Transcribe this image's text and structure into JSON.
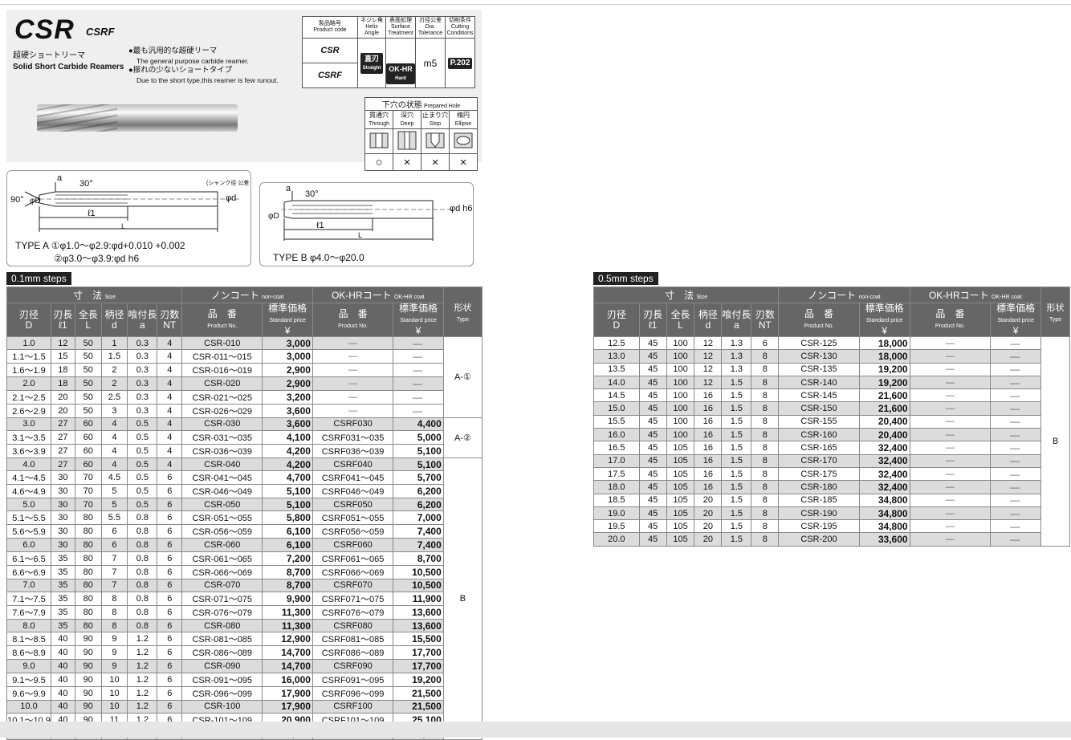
{
  "product": {
    "code": "CSR",
    "variant": "CSRF",
    "name_jp": "超硬ショートリーマ",
    "name_en": "Solid Short Carbide Reamers",
    "bullet1_jp": "●最も汎用的な超硬リーマ",
    "bullet1_en": "The general purpose carbide reamer.",
    "bullet2_jp": "●振れの少ないショートタイプ",
    "bullet2_en": "Due to the short type,this reamer is few runout."
  },
  "spec": {
    "h_code": "製品略号",
    "h_code_en": "Product code",
    "h_helix": "ネジレ角",
    "h_helix_en": "Helix Angle",
    "h_surface": "表面処理",
    "h_surface_en": "Surface Treatment",
    "h_tol": "刃径公差",
    "h_tol_en": "Dia. Tolerance",
    "h_cut": "切削条件",
    "h_cut_en": "Cutting Conditions",
    "row1": "CSR",
    "row2": "CSRF",
    "straight_jp": "直刃",
    "straight_en": "Straight",
    "hard": "OK-HR",
    "hard_en": "Hard",
    "tolerance": "m5",
    "page_ref": "P.202"
  },
  "prepared_hole": {
    "title": "下穴の状態",
    "title_en": "Prepared Hole",
    "cols": [
      {
        "jp": "貫通穴",
        "en": "Through",
        "mark": "○"
      },
      {
        "jp": "深穴",
        "en": "Deep",
        "mark": "×"
      },
      {
        "jp": "止まり穴",
        "en": "Stop",
        "mark": "×"
      },
      {
        "jp": "楕円",
        "en": "Ellipse",
        "mark": "×"
      }
    ]
  },
  "diagram_a": {
    "a": "a",
    "angle": "30°",
    "angle90": "90°",
    "l1": "ℓ1",
    "L": "L",
    "phiD": "φD",
    "phid": "φd",
    "shank_note": "(シャンク径 公差",
    "type_label": "TYPE A ①φ1.0～φ2.9:φd+0.010 +0.002",
    "type_label2": "②φ3.0～φ3.9:φd h6"
  },
  "diagram_b": {
    "a": "a",
    "angle": "30°",
    "l1": "ℓ1",
    "L": "L",
    "phiD": "φD",
    "phid": "φd h6",
    "type_label": "TYPE B φ4.0～φ20.0"
  },
  "table_headers": {
    "size": "寸　法",
    "size_en": "Size",
    "noncoat": "ノンコート",
    "noncoat_en": "non-coat",
    "okhr": "OK-HRコート",
    "okhr_en": "OK-HR coat",
    "shape": "形状",
    "shape_en": "Type",
    "D": "刃径",
    "D_sym": "D",
    "l1": "刃長",
    "l1_sym": "ℓ1",
    "L": "全長",
    "L_sym": "L",
    "d": "柄径",
    "d_sym": "d",
    "a": "喰付長",
    "a_sym": "a",
    "nt": "刃数",
    "nt_sym": "NT",
    "pn": "品　番",
    "pn_en": "Product No.",
    "price": "標準価格",
    "price_en": "Standard price",
    "yen": "¥"
  },
  "left_table": {
    "tag": "0.1mm steps",
    "type_labels": {
      "a1": "A-①",
      "a2": "A-②",
      "b": "B"
    },
    "rows": [
      {
        "D": "1.0",
        "l1": "12",
        "L": "50",
        "d": "1",
        "a": "0.3",
        "nt": "4",
        "pn": "CSR-010",
        "price": "3,000",
        "hr_pn": "—",
        "hr_price": "—",
        "shade": true
      },
      {
        "D": "1.1～1.5",
        "l1": "15",
        "L": "50",
        "d": "1.5",
        "a": "0.3",
        "nt": "4",
        "pn": "CSR-011～015",
        "price": "3,000",
        "hr_pn": "—",
        "hr_price": "—",
        "shade": false
      },
      {
        "D": "1.6～1.9",
        "l1": "18",
        "L": "50",
        "d": "2",
        "a": "0.3",
        "nt": "4",
        "pn": "CSR-016～019",
        "price": "2,900",
        "hr_pn": "—",
        "hr_price": "—",
        "shade": false
      },
      {
        "D": "2.0",
        "l1": "18",
        "L": "50",
        "d": "2",
        "a": "0.3",
        "nt": "4",
        "pn": "CSR-020",
        "price": "2,900",
        "hr_pn": "—",
        "hr_price": "—",
        "shade": true
      },
      {
        "D": "2.1～2.5",
        "l1": "20",
        "L": "50",
        "d": "2.5",
        "a": "0.3",
        "nt": "4",
        "pn": "CSR-021～025",
        "price": "3,200",
        "hr_pn": "—",
        "hr_price": "—",
        "shade": false
      },
      {
        "D": "2.6～2.9",
        "l1": "20",
        "L": "50",
        "d": "3",
        "a": "0.3",
        "nt": "4",
        "pn": "CSR-026～029",
        "price": "3,600",
        "hr_pn": "—",
        "hr_price": "—",
        "shade": false
      },
      {
        "D": "3.0",
        "l1": "27",
        "L": "60",
        "d": "4",
        "a": "0.5",
        "nt": "4",
        "pn": "CSR-030",
        "price": "3,600",
        "hr_pn": "CSRF030",
        "hr_price": "4,400",
        "shade": true
      },
      {
        "D": "3.1～3.5",
        "l1": "27",
        "L": "60",
        "d": "4",
        "a": "0.5",
        "nt": "4",
        "pn": "CSR-031～035",
        "price": "4,100",
        "hr_pn": "CSRF031～035",
        "hr_price": "5,000",
        "shade": false
      },
      {
        "D": "3.6～3.9",
        "l1": "27",
        "L": "60",
        "d": "4",
        "a": "0.5",
        "nt": "4",
        "pn": "CSR-036～039",
        "price": "4,200",
        "hr_pn": "CSRF036～039",
        "hr_price": "5,100",
        "shade": false
      },
      {
        "D": "4.0",
        "l1": "27",
        "L": "60",
        "d": "4",
        "a": "0.5",
        "nt": "4",
        "pn": "CSR-040",
        "price": "4,200",
        "hr_pn": "CSRF040",
        "hr_price": "5,100",
        "shade": true
      },
      {
        "D": "4.1～4.5",
        "l1": "30",
        "L": "70",
        "d": "4.5",
        "a": "0.5",
        "nt": "6",
        "pn": "CSR-041～045",
        "price": "4,700",
        "hr_pn": "CSRF041～045",
        "hr_price": "5,700",
        "shade": false
      },
      {
        "D": "4.6～4.9",
        "l1": "30",
        "L": "70",
        "d": "5",
        "a": "0.5",
        "nt": "6",
        "pn": "CSR-046～049",
        "price": "5,100",
        "hr_pn": "CSRF046～049",
        "hr_price": "6,200",
        "shade": false
      },
      {
        "D": "5.0",
        "l1": "30",
        "L": "70",
        "d": "5",
        "a": "0.5",
        "nt": "6",
        "pn": "CSR-050",
        "price": "5,100",
        "hr_pn": "CSRF050",
        "hr_price": "6,200",
        "shade": true
      },
      {
        "D": "5.1～5.5",
        "l1": "30",
        "L": "80",
        "d": "5.5",
        "a": "0.8",
        "nt": "6",
        "pn": "CSR-051～055",
        "price": "5,800",
        "hr_pn": "CSRF051～055",
        "hr_price": "7,000",
        "shade": false
      },
      {
        "D": "5.6～5.9",
        "l1": "30",
        "L": "80",
        "d": "6",
        "a": "0.8",
        "nt": "6",
        "pn": "CSR-056～059",
        "price": "6,100",
        "hr_pn": "CSRF056～059",
        "hr_price": "7,400",
        "shade": false
      },
      {
        "D": "6.0",
        "l1": "30",
        "L": "80",
        "d": "6",
        "a": "0.8",
        "nt": "6",
        "pn": "CSR-060",
        "price": "6,100",
        "hr_pn": "CSRF060",
        "hr_price": "7,400",
        "shade": true
      },
      {
        "D": "6.1～6.5",
        "l1": "35",
        "L": "80",
        "d": "7",
        "a": "0.8",
        "nt": "6",
        "pn": "CSR-061～065",
        "price": "7,200",
        "hr_pn": "CSRF061～065",
        "hr_price": "8,700",
        "shade": false
      },
      {
        "D": "6.6～6.9",
        "l1": "35",
        "L": "80",
        "d": "7",
        "a": "0.8",
        "nt": "6",
        "pn": "CSR-066～069",
        "price": "8,700",
        "hr_pn": "CSRF066～069",
        "hr_price": "10,500",
        "shade": false
      },
      {
        "D": "7.0",
        "l1": "35",
        "L": "80",
        "d": "7",
        "a": "0.8",
        "nt": "6",
        "pn": "CSR-070",
        "price": "8,700",
        "hr_pn": "CSRF070",
        "hr_price": "10,500",
        "shade": true
      },
      {
        "D": "7.1～7.5",
        "l1": "35",
        "L": "80",
        "d": "8",
        "a": "0.8",
        "nt": "6",
        "pn": "CSR-071～075",
        "price": "9,900",
        "hr_pn": "CSRF071～075",
        "hr_price": "11,900",
        "shade": false
      },
      {
        "D": "7.6～7.9",
        "l1": "35",
        "L": "80",
        "d": "8",
        "a": "0.8",
        "nt": "6",
        "pn": "CSR-076～079",
        "price": "11,300",
        "hr_pn": "CSRF076～079",
        "hr_price": "13,600",
        "shade": false
      },
      {
        "D": "8.0",
        "l1": "35",
        "L": "80",
        "d": "8",
        "a": "0.8",
        "nt": "6",
        "pn": "CSR-080",
        "price": "11,300",
        "hr_pn": "CSRF080",
        "hr_price": "13,600",
        "shade": true
      },
      {
        "D": "8.1～8.5",
        "l1": "40",
        "L": "90",
        "d": "9",
        "a": "1.2",
        "nt": "6",
        "pn": "CSR-081～085",
        "price": "12,900",
        "hr_pn": "CSRF081～085",
        "hr_price": "15,500",
        "shade": false
      },
      {
        "D": "8.6～8.9",
        "l1": "40",
        "L": "90",
        "d": "9",
        "a": "1.2",
        "nt": "6",
        "pn": "CSR-086～089",
        "price": "14,700",
        "hr_pn": "CSRF086～089",
        "hr_price": "17,700",
        "shade": false
      },
      {
        "D": "9.0",
        "l1": "40",
        "L": "90",
        "d": "9",
        "a": "1.2",
        "nt": "6",
        "pn": "CSR-090",
        "price": "14,700",
        "hr_pn": "CSRF090",
        "hr_price": "17,700",
        "shade": true
      },
      {
        "D": "9.1～9.5",
        "l1": "40",
        "L": "90",
        "d": "10",
        "a": "1.2",
        "nt": "6",
        "pn": "CSR-091～095",
        "price": "16,000",
        "hr_pn": "CSRF091～095",
        "hr_price": "19,200",
        "shade": false
      },
      {
        "D": "9.6～9.9",
        "l1": "40",
        "L": "90",
        "d": "10",
        "a": "1.2",
        "nt": "6",
        "pn": "CSR-096～099",
        "price": "17,900",
        "hr_pn": "CSRF096～099",
        "hr_price": "21,500",
        "shade": false
      },
      {
        "D": "10.0",
        "l1": "40",
        "L": "90",
        "d": "10",
        "a": "1.2",
        "nt": "6",
        "pn": "CSR-100",
        "price": "17,900",
        "hr_pn": "CSRF100",
        "hr_price": "21,500",
        "shade": true
      },
      {
        "D": "10.1～10.9",
        "l1": "40",
        "L": "90",
        "d": "11",
        "a": "1.2",
        "nt": "6",
        "pn": "CSR-101～109",
        "price": "20,900",
        "hr_pn": "CSRF101～109",
        "hr_price": "25,100",
        "shade": false
      },
      {
        "D": "11.0",
        "l1": "40",
        "L": "90",
        "d": "11",
        "a": "1.2",
        "nt": "6",
        "pn": "CSR-110",
        "price": "20,900",
        "hr_pn": "CSRF110",
        "hr_price": "25,100",
        "shade": true
      }
    ]
  },
  "right_table": {
    "tag": "0.5mm steps",
    "type_label": "B",
    "rows": [
      {
        "D": "12.5",
        "l1": "45",
        "L": "100",
        "d": "12",
        "a": "1.3",
        "nt": "6",
        "pn": "CSR-125",
        "price": "18,000",
        "hr_pn": "—",
        "hr_price": "—",
        "shade": false
      },
      {
        "D": "13.0",
        "l1": "45",
        "L": "100",
        "d": "12",
        "a": "1.3",
        "nt": "8",
        "pn": "CSR-130",
        "price": "18,000",
        "hr_pn": "—",
        "hr_price": "—",
        "shade": true
      },
      {
        "D": "13.5",
        "l1": "45",
        "L": "100",
        "d": "12",
        "a": "1.3",
        "nt": "8",
        "pn": "CSR-135",
        "price": "19,200",
        "hr_pn": "—",
        "hr_price": "—",
        "shade": false
      },
      {
        "D": "14.0",
        "l1": "45",
        "L": "100",
        "d": "12",
        "a": "1.5",
        "nt": "8",
        "pn": "CSR-140",
        "price": "19,200",
        "hr_pn": "—",
        "hr_price": "—",
        "shade": true
      },
      {
        "D": "14.5",
        "l1": "45",
        "L": "100",
        "d": "16",
        "a": "1.5",
        "nt": "8",
        "pn": "CSR-145",
        "price": "21,600",
        "hr_pn": "—",
        "hr_price": "—",
        "shade": false
      },
      {
        "D": "15.0",
        "l1": "45",
        "L": "100",
        "d": "16",
        "a": "1.5",
        "nt": "8",
        "pn": "CSR-150",
        "price": "21,600",
        "hr_pn": "—",
        "hr_price": "—",
        "shade": true
      },
      {
        "D": "15.5",
        "l1": "45",
        "L": "100",
        "d": "16",
        "a": "1.5",
        "nt": "8",
        "pn": "CSR-155",
        "price": "20,400",
        "hr_pn": "—",
        "hr_price": "—",
        "shade": false
      },
      {
        "D": "16.0",
        "l1": "45",
        "L": "100",
        "d": "16",
        "a": "1.5",
        "nt": "8",
        "pn": "CSR-160",
        "price": "20,400",
        "hr_pn": "—",
        "hr_price": "—",
        "shade": true
      },
      {
        "D": "16.5",
        "l1": "45",
        "L": "105",
        "d": "16",
        "a": "1.5",
        "nt": "8",
        "pn": "CSR-165",
        "price": "32,400",
        "hr_pn": "—",
        "hr_price": "—",
        "shade": false
      },
      {
        "D": "17.0",
        "l1": "45",
        "L": "105",
        "d": "16",
        "a": "1.5",
        "nt": "8",
        "pn": "CSR-170",
        "price": "32,400",
        "hr_pn": "—",
        "hr_price": "—",
        "shade": true
      },
      {
        "D": "17.5",
        "l1": "45",
        "L": "105",
        "d": "16",
        "a": "1.5",
        "nt": "8",
        "pn": "CSR-175",
        "price": "32,400",
        "hr_pn": "—",
        "hr_price": "—",
        "shade": false
      },
      {
        "D": "18.0",
        "l1": "45",
        "L": "105",
        "d": "16",
        "a": "1.5",
        "nt": "8",
        "pn": "CSR-180",
        "price": "32,400",
        "hr_pn": "—",
        "hr_price": "—",
        "shade": true
      },
      {
        "D": "18.5",
        "l1": "45",
        "L": "105",
        "d": "20",
        "a": "1.5",
        "nt": "8",
        "pn": "CSR-185",
        "price": "34,800",
        "hr_pn": "—",
        "hr_price": "—",
        "shade": false
      },
      {
        "D": "19.0",
        "l1": "45",
        "L": "105",
        "d": "20",
        "a": "1.5",
        "nt": "8",
        "pn": "CSR-190",
        "price": "34,800",
        "hr_pn": "—",
        "hr_price": "—",
        "shade": true
      },
      {
        "D": "19.5",
        "l1": "45",
        "L": "105",
        "d": "20",
        "a": "1.5",
        "nt": "8",
        "pn": "CSR-195",
        "price": "34,800",
        "hr_pn": "—",
        "hr_price": "—",
        "shade": false
      },
      {
        "D": "20.0",
        "l1": "45",
        "L": "105",
        "d": "20",
        "a": "1.5",
        "nt": "8",
        "pn": "CSR-200",
        "price": "33,600",
        "hr_pn": "—",
        "hr_price": "—",
        "shade": true
      }
    ]
  }
}
